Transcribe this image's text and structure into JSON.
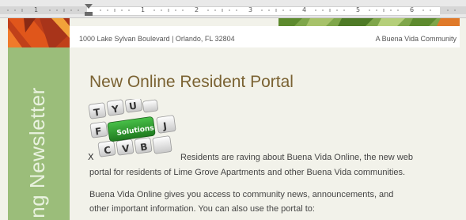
{
  "ruler": {
    "numbers": [
      "1",
      "1",
      "2",
      "3",
      "4",
      "5",
      "6"
    ]
  },
  "header": {
    "address": "1000 Lake Sylvan Boulevard | Orlando, FL 32804",
    "community": "A Buena Vida Community"
  },
  "sidebar": {
    "vertical_text": "ing Newsletter"
  },
  "article": {
    "title": "New Online Resident Portal",
    "image_key_label": "Solutions",
    "paragraph1_line1": "Residents are raving about Buena Vida Online, the new web",
    "paragraph1_line2": "portal for residents of Lime Grove Apartments and other Buena Vida communities.",
    "paragraph2_line1": "Buena Vida Online gives you access to community news, announcements, and",
    "paragraph2_line2": "other important information. You can also use the portal to:"
  },
  "colors": {
    "sidebar": "#9bbd7a",
    "title": "#7a6232",
    "page_bg": "#f2f2ea",
    "banner_orange": "#e0561b",
    "key_green": "#2e9b2e"
  }
}
